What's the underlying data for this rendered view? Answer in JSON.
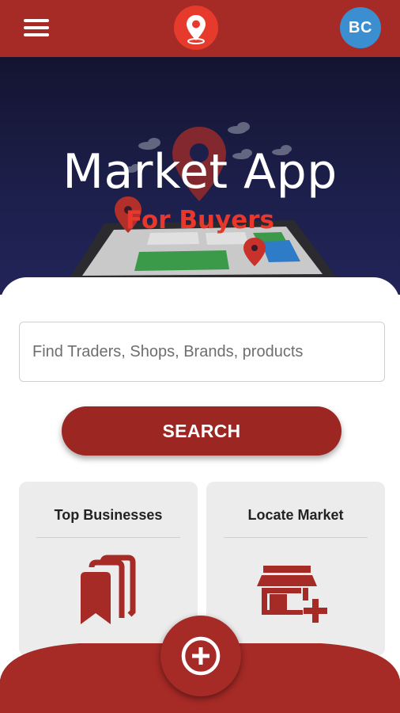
{
  "header": {
    "menu_icon": "hamburger-menu-icon",
    "logo_icon": "map-pin-icon",
    "avatar_initials": "BC"
  },
  "hero": {
    "title": "Market App",
    "subtitle": "For Buyers"
  },
  "search": {
    "placeholder": "Find Traders, Shops, Brands, products",
    "button_label": "SEARCH"
  },
  "cards": [
    {
      "title": "Top Businesses",
      "icon": "bookmarks-icon"
    },
    {
      "title": "Locate Market",
      "icon": "add-store-icon"
    }
  ],
  "fab": {
    "icon": "plus-circle-icon"
  },
  "colors": {
    "primary": "#a62a26",
    "button": "#9c2621",
    "logo": "#e53a2c",
    "accent_text": "#e8372c",
    "avatar": "#3b8ed0",
    "card_bg": "#ececec"
  }
}
